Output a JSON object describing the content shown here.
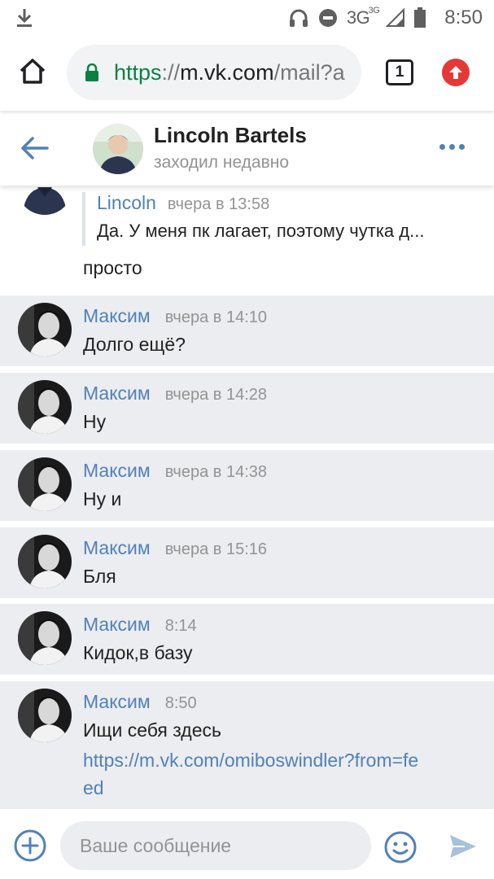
{
  "status_bar": {
    "network": "3G",
    "network_super": "3G",
    "time": "8:50",
    "icons": [
      "download-icon",
      "headset-icon",
      "do-not-disturb-icon",
      "signal-icon",
      "battery-icon"
    ]
  },
  "browser": {
    "url_scheme": "https",
    "url_sep": "://",
    "url_host": "m.vk.com",
    "url_rest": "/mail?a",
    "tabs_count": "1",
    "icons": [
      "home-icon",
      "lock-icon",
      "tabs-icon",
      "update-icon"
    ],
    "colors": {
      "secure": "#0b8043",
      "update": "#e53935"
    }
  },
  "chat": {
    "name": "Lincoln Bartels",
    "status": "заходил недавно",
    "icons": [
      "back-arrow-icon",
      "more-icon"
    ]
  },
  "first_message": {
    "reply_author": "Lincoln",
    "reply_time": "вчера в 13:58",
    "reply_text": "Да. У меня пк лагает, поэтому чутка д...",
    "text": "просто"
  },
  "messages": [
    {
      "author": "Максим",
      "time": "вчера в 14:10",
      "text": "Долго ещё?"
    },
    {
      "author": "Максим",
      "time": "вчера в 14:28",
      "text": "Ну"
    },
    {
      "author": "Максим",
      "time": "вчера в 14:38",
      "text": "Ну и"
    },
    {
      "author": "Максим",
      "time": "вчера в 15:16",
      "text": "Бля"
    },
    {
      "author": "Максим",
      "time": "8:14",
      "text": "Кидок,в базу"
    },
    {
      "author": "Максим",
      "time": "8:50",
      "text": "Ищи себя здесь",
      "link": "https://m.vk.com/omiboswindler?from=feed"
    }
  ],
  "composer": {
    "placeholder": "Ваше сообщение",
    "icons": [
      "add-icon",
      "emoji-icon",
      "send-icon"
    ]
  },
  "colors": {
    "accent": "#5181b8",
    "message_bg": "#ebedf0",
    "muted": "#939393"
  }
}
